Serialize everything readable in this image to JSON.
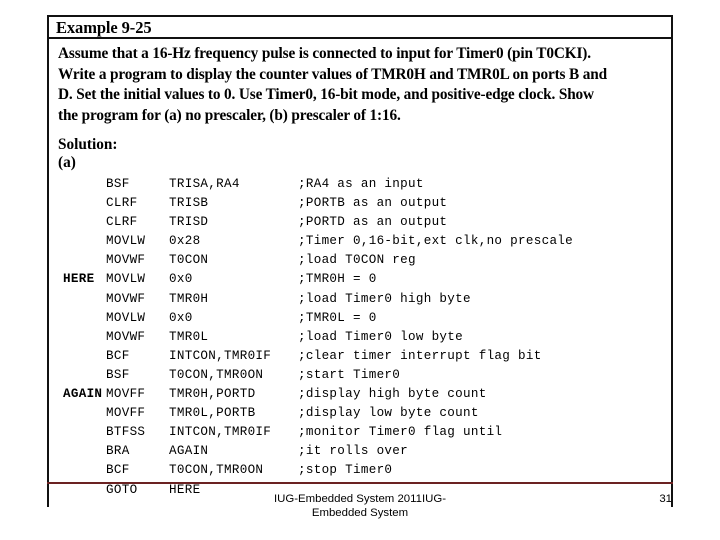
{
  "slide": {
    "example_title": "Example 9-25",
    "statement_lines": [
      "Assume that a 16-Hz frequency pulse is connected to input for Timer0 (pin T0CKI).",
      "Write a program to display the counter values of TMR0H and TMR0L on ports B and",
      "D. Set the initial values to 0. Use Timer0, 16-bit mode, and positive-edge clock. Show",
      "the program for (a) no prescaler, (b) prescaler of 1:16."
    ],
    "solution_heading": "Solution:",
    "solution_part": "(a)",
    "code_columns": [
      "label",
      "mnemonic",
      "operand",
      "comment"
    ],
    "code_rows": [
      {
        "label": "",
        "mnemonic": "BSF",
        "operand": "TRISA,RA4",
        "comment": ";RA4 as an input"
      },
      {
        "label": "",
        "mnemonic": "CLRF",
        "operand": "TRISB",
        "comment": ";PORTB as an output"
      },
      {
        "label": "",
        "mnemonic": "CLRF",
        "operand": "TRISD",
        "comment": ";PORTD as an output"
      },
      {
        "label": "",
        "mnemonic": "MOVLW",
        "operand": "0x28",
        "comment": ";Timer 0,16-bit,ext clk,no prescale"
      },
      {
        "label": "",
        "mnemonic": "MOVWF",
        "operand": "T0CON",
        "comment": ";load T0CON reg"
      },
      {
        "label": "HERE",
        "mnemonic": "MOVLW",
        "operand": "0x0",
        "comment": ";TMR0H = 0"
      },
      {
        "label": "",
        "mnemonic": "MOVWF",
        "operand": "TMR0H",
        "comment": ";load Timer0 high byte"
      },
      {
        "label": "",
        "mnemonic": "MOVLW",
        "operand": "0x0",
        "comment": ";TMR0L = 0"
      },
      {
        "label": "",
        "mnemonic": "MOVWF",
        "operand": "TMR0L",
        "comment": ";load Timer0 low byte"
      },
      {
        "label": "",
        "mnemonic": "BCF",
        "operand": "INTCON,TMR0IF",
        "comment": ";clear timer interrupt flag bit"
      },
      {
        "label": "",
        "mnemonic": "BSF",
        "operand": "T0CON,TMR0ON",
        "comment": ";start Timer0"
      },
      {
        "label": "AGAIN",
        "mnemonic": "MOVFF",
        "operand": "TMR0H,PORTD",
        "comment": ";display high byte count"
      },
      {
        "label": "",
        "mnemonic": "MOVFF",
        "operand": "TMR0L,PORTB",
        "comment": ";display low byte count"
      },
      {
        "label": "",
        "mnemonic": "BTFSS",
        "operand": "INTCON,TMR0IF",
        "comment": ";monitor Timer0 flag until"
      },
      {
        "label": "",
        "mnemonic": "BRA",
        "operand": "AGAIN",
        "comment": ";it rolls over"
      },
      {
        "label": "",
        "mnemonic": "BCF",
        "operand": "T0CON,TMR0ON",
        "comment": ";stop Timer0"
      },
      {
        "label": "",
        "mnemonic": "GOTO",
        "operand": "HERE",
        "comment": ""
      }
    ]
  },
  "footer": {
    "line1": "IUG-Embedded System 2011IUG-",
    "line2": "Embedded System",
    "page_number": "31"
  },
  "colors": {
    "frame_border": "#111111",
    "bottom_rule": "#6b2222",
    "text": "#000000",
    "background": "#ffffff"
  }
}
